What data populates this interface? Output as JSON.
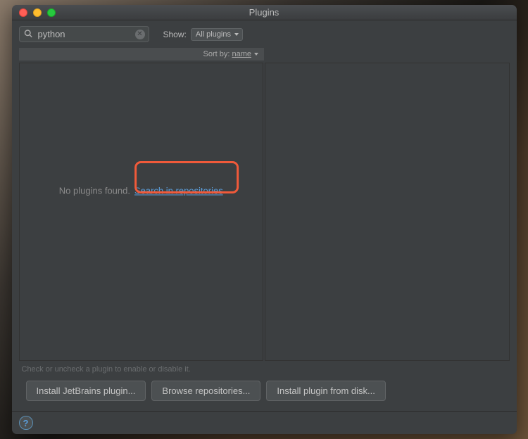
{
  "window": {
    "title": "Plugins"
  },
  "toolbar": {
    "search_value": "python",
    "show_label": "Show:",
    "show_selected": "All plugins"
  },
  "sort": {
    "label": "Sort by:",
    "value": "name"
  },
  "empty": {
    "msg": "No plugins found.",
    "link": "Search in repositories"
  },
  "hint": "Check or uncheck a plugin to enable or disable it.",
  "buttons": {
    "install_jetbrains": "Install JetBrains plugin...",
    "browse": "Browse repositories...",
    "from_disk": "Install plugin from disk..."
  },
  "footer": {
    "help": "?"
  }
}
